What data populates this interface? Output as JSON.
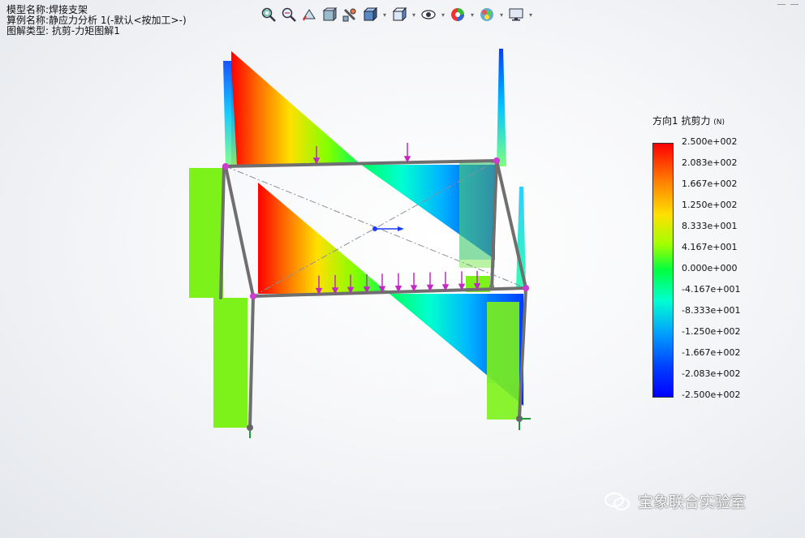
{
  "info": {
    "model": "模型名称:焊接支架",
    "study": "算例名称:静应力分析 1(-默认<按加工>-)",
    "plot_type": "图解类型: 抗剪-力矩图解1"
  },
  "toolbar": {
    "icons": [
      "zoom-fit-icon",
      "zoom-area-icon",
      "previous-view-icon",
      "section-view-icon",
      "dynamic-annotation-icon",
      "display-style-icon",
      "view-orientation-icon",
      "hide-show-icon",
      "edit-appearance-icon",
      "apply-scene-icon",
      "view-settings-icon"
    ]
  },
  "legend": {
    "title": "方向1 抗剪力",
    "unit": "(N)",
    "ticks": [
      "2.500e+002",
      "2.083e+002",
      "1.667e+002",
      "1.250e+002",
      "8.333e+001",
      "4.167e+001",
      "0.000e+000",
      "-4.167e+001",
      "-8.333e+001",
      "-1.250e+002",
      "-1.667e+002",
      "-2.083e+002",
      "-2.500e+002"
    ],
    "colors": {
      "max": "#ff0000",
      "mid": "#00ff40",
      "min": "#0000ff"
    }
  },
  "watermark": {
    "text": "宝象联合实验室"
  }
}
